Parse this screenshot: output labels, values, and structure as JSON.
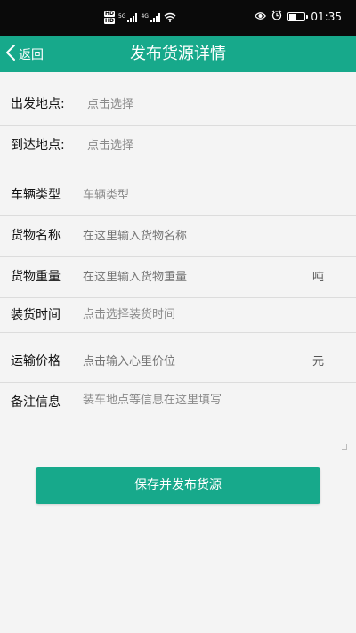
{
  "status_bar": {
    "hd_badge_1": "HD",
    "hd_badge_2": "HD",
    "network_1": "5G",
    "network_2": "4G",
    "time": "01:35",
    "battery_level": 0.55
  },
  "header": {
    "back_label": "返回",
    "title": "发布货源详情",
    "background_color": "#17a98b"
  },
  "form": {
    "origin": {
      "label": "出发地点:",
      "placeholder": "点击选择"
    },
    "destination": {
      "label": "到达地点:",
      "placeholder": "点击选择"
    },
    "vehicle_type": {
      "label": "车辆类型",
      "placeholder": "车辆类型"
    },
    "cargo_name": {
      "label": "货物名称",
      "placeholder": "在这里输入货物名称"
    },
    "cargo_weight": {
      "label": "货物重量",
      "placeholder": "在这里输入货物重量",
      "unit": "吨"
    },
    "loading_time": {
      "label": "装货时间",
      "placeholder": "点击选择装货时间"
    },
    "price": {
      "label": "运输价格",
      "placeholder": "点击输入心里价位",
      "unit": "元"
    },
    "remarks": {
      "label": "备注信息",
      "placeholder": "装车地点等信息在这里填写"
    }
  },
  "submit": {
    "label": "保存并发布货源"
  },
  "icons": {
    "back": "chevron-left-icon",
    "eye": "eye-icon",
    "alarm": "alarm-icon",
    "wifi": "wifi-icon",
    "battery": "battery-icon"
  }
}
